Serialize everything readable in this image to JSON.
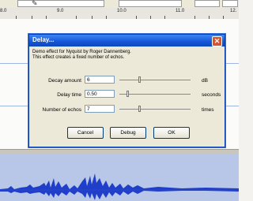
{
  "ruler": {
    "ticks": [
      "8.0",
      "9.0",
      "10.0",
      "11.0",
      "12."
    ]
  },
  "dialog": {
    "title": "Delay...",
    "description_line1": "Demo effect for Nyquist by Roger Dannenberg.",
    "description_line2": "This effect creates a fixed number of echos.",
    "close_glyph": "✕",
    "params": [
      {
        "label": "Decay amount",
        "value": "6",
        "unit": "dB",
        "slider_fraction": 0.28
      },
      {
        "label": "Delay time",
        "value": "0.50",
        "unit": "seconds",
        "slider_fraction": 0.1
      },
      {
        "label": "Number of echos",
        "value": "7",
        "unit": "times",
        "slider_fraction": 0.28
      }
    ],
    "buttons": {
      "cancel": "Cancel",
      "debug": "Debug",
      "ok": "OK"
    }
  },
  "colors": {
    "titlebar": "#1456d6",
    "waveform": "#1f3ec9",
    "track_selected": "#b8c6e8"
  },
  "icons": {
    "close": "close-icon",
    "tool": "pencil-icon"
  }
}
